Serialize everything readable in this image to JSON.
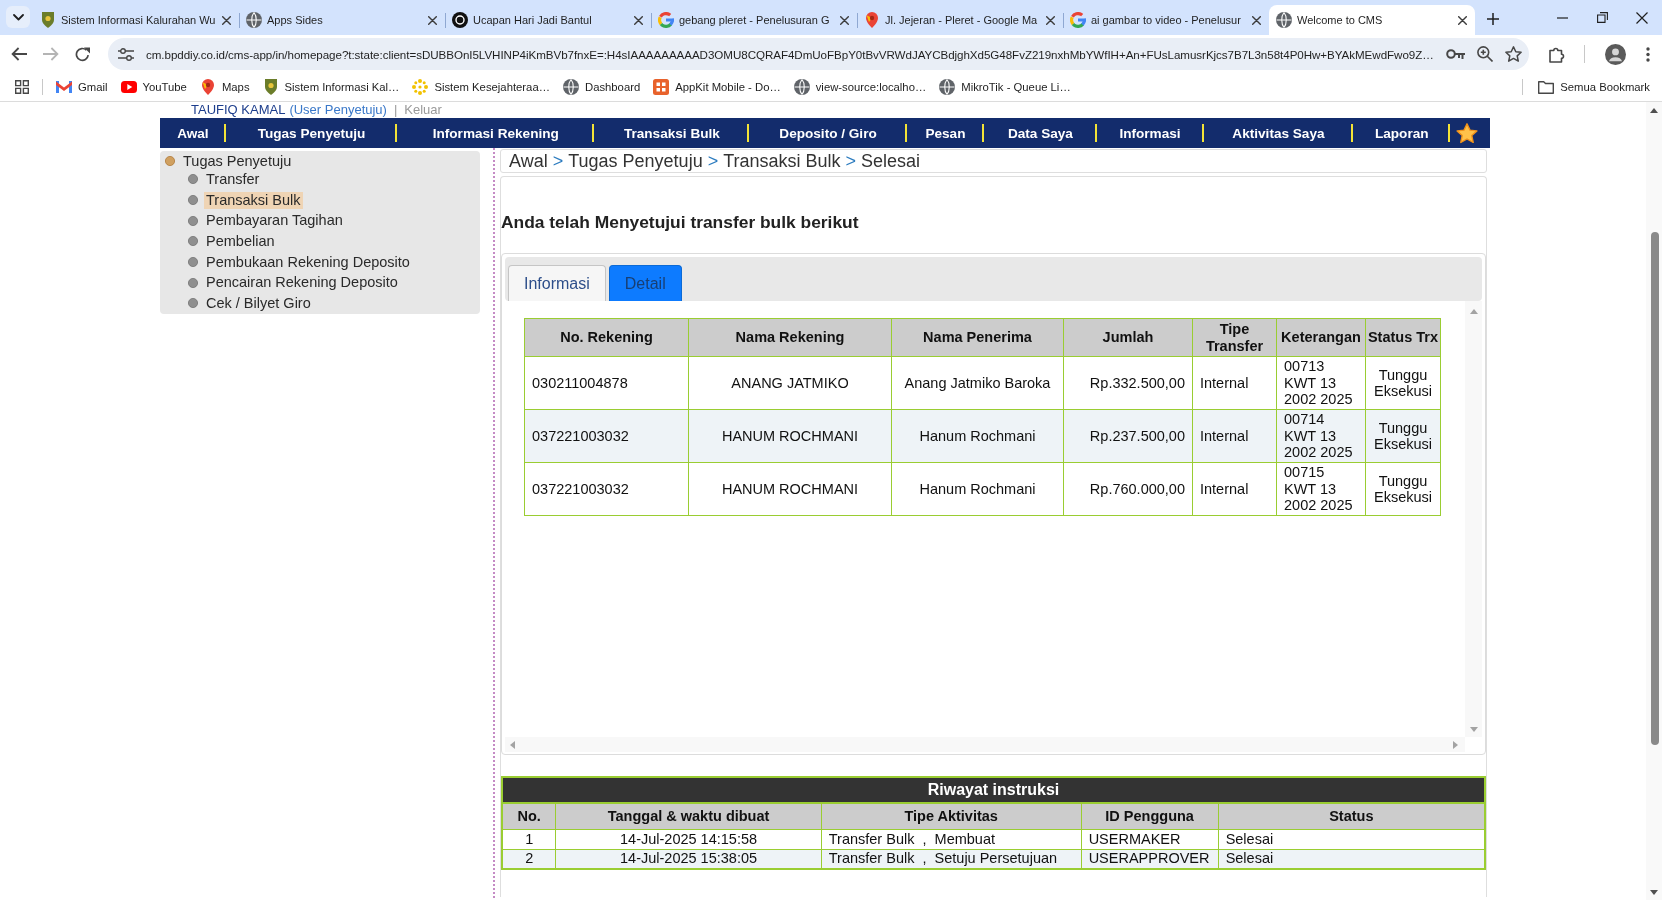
{
  "browser": {
    "tabs": [
      {
        "title": "Sistem Informasi Kalurahan Wu",
        "kind": "emblem",
        "selected": false
      },
      {
        "title": "Apps Sides",
        "kind": "globe",
        "selected": false
      },
      {
        "title": "Ucapan Hari Jadi Bantul",
        "kind": "disc",
        "selected": false
      },
      {
        "title": "gebang pleret - Penelusuran G",
        "kind": "ring",
        "selected": false
      },
      {
        "title": "Jl. Jejeran - Pleret - Google Ma",
        "kind": "pin",
        "selected": false
      },
      {
        "title": "ai gambar to video - Penelusur",
        "kind": "ring",
        "selected": false
      },
      {
        "title": "Welcome to CMS",
        "kind": "globe",
        "selected": true
      }
    ],
    "forward_disabled": true,
    "url": "cm.bpddiy.co.id/cms-app/in/homepage?t:state:client=sDUBBOnI5LVHINP4iKmBVb7fnxE=:H4sIAAAAAAAAAD3OMU8CQRAF4DmUoFBpY0tBvVRWdJAYCBdjghXd5G48FvZ219nxhMbYWfIH+An+FUsLamusrKjcs7B7L3n58t4P0Hw+BYAkMEwdFwo9Z…",
    "bookmarks": [
      {
        "label": "Gmail",
        "kind": "envelope"
      },
      {
        "label": "YouTube",
        "kind": "play"
      },
      {
        "label": "Maps",
        "kind": "pin"
      },
      {
        "label": "Sistem Informasi Kal…",
        "kind": "emblem"
      },
      {
        "label": "Sistem Kesejahteraa…",
        "kind": "flower"
      },
      {
        "label": "Dashboard",
        "kind": "globe"
      },
      {
        "label": "AppKit Mobile - Do…",
        "kind": "tile"
      },
      {
        "label": "view-source:localho…",
        "kind": "globe"
      },
      {
        "label": "MikroTik - Queue Li…",
        "kind": "globe"
      }
    ],
    "all_bookmarks": "Semua Bookmark"
  },
  "user_bar": {
    "name": "TAUFIQ KAMAL",
    "role": "(User Penyetuju)",
    "separator": "|",
    "logout": "Keluar"
  },
  "nav_menu": [
    "Awal",
    "Tugas Penyetuju",
    "Informasi Rekening",
    "Transaksi Bulk",
    "Deposito / Giro",
    "Pesan",
    "Data Saya",
    "Informasi",
    "Aktivitas Saya",
    "Laporan"
  ],
  "sidebar": {
    "items": [
      {
        "label": "Tugas Penyetuju",
        "selected": false,
        "children": [
          {
            "label": "Transfer",
            "selected": false
          },
          {
            "label": "Transaksi Bulk",
            "selected": true
          },
          {
            "label": "Pembayaran Tagihan",
            "selected": false
          },
          {
            "label": "Pembelian",
            "selected": false
          },
          {
            "label": "Pembukaan Rekening Deposito",
            "selected": false
          },
          {
            "label": "Pencairan Rekening Deposito",
            "selected": false
          },
          {
            "label": "Cek / Bilyet Giro",
            "selected": false
          }
        ]
      }
    ]
  },
  "breadcrumb": {
    "items": [
      "Awal",
      "Tugas Penyetuju",
      "Transaksi Bulk",
      "Selesai"
    ],
    "separator": ">"
  },
  "heading": "Anda telah Menyetujui transfer bulk berikut",
  "tabs": [
    {
      "label": "Informasi",
      "selected": false
    },
    {
      "label": "Detail",
      "selected": true
    }
  ],
  "table": {
    "columns": [
      "No. Rekening",
      "Nama Rekening",
      "Nama Penerima",
      "Jumlah",
      "Tipe Transfer",
      "Keterangan",
      "Status Trx"
    ],
    "rows": [
      [
        "030211004878",
        "ANANG JATMIKO",
        "Anang Jatmiko Baroka",
        "Rp.332.500,00",
        "Internal",
        "00713 KWT 13 2002 2025",
        "Tunggu Eksekusi"
      ],
      [
        "037221003032",
        "HANUM ROCHMANI",
        "Hanum Rochmani",
        "Rp.237.500,00",
        "Internal",
        "00714 KWT 13 2002 2025",
        "Tunggu Eksekusi"
      ],
      [
        "037221003032",
        "HANUM ROCHMANI",
        "Hanum Rochmani",
        "Rp.760.000,00",
        "Internal",
        "00715 KWT 13 2002 2025",
        "Tunggu Eksekusi"
      ]
    ]
  },
  "history": {
    "title": "Riwayat instruksi",
    "columns": [
      "No.",
      "Tanggal & waktu dibuat",
      "Tipe Aktivitas",
      "ID Pengguna",
      "Status"
    ],
    "rows": [
      [
        "1",
        "14-Jul-2025 14:15:58",
        "Transfer Bulk  ,  Membuat",
        "USERMAKER",
        "Selesai"
      ],
      [
        "2",
        "14-Jul-2025 15:38:05",
        "Transfer Bulk  ,  Setuju Persetujuan",
        "USERAPPROVER",
        "Selesai"
      ]
    ]
  }
}
